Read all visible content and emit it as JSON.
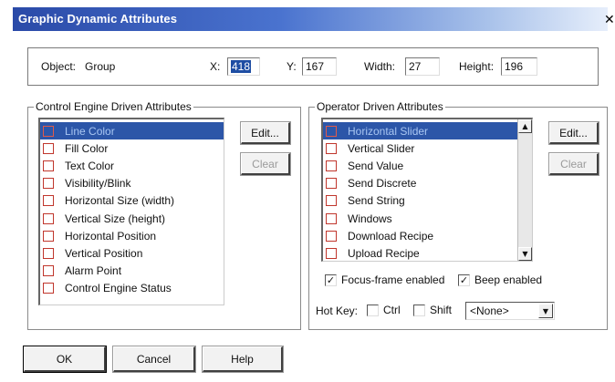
{
  "window": {
    "title": "Graphic Dynamic Attributes",
    "close_icon": "x-icon"
  },
  "object": {
    "label": "Object:",
    "name": "Group",
    "x_label": "X:",
    "x_value": "418",
    "y_label": "Y:",
    "y_value": "167",
    "width_label": "Width:",
    "width_value": "27",
    "height_label": "Height:",
    "height_value": "196"
  },
  "control_engine": {
    "legend": "Control Engine Driven Attributes",
    "items": [
      "Line Color",
      "Fill Color",
      "Text Color",
      "Visibility/Blink",
      "Horizontal Size (width)",
      "Vertical Size (height)",
      "Horizontal Position",
      "Vertical Position",
      "Alarm Point",
      "Control Engine Status"
    ],
    "selected_index": 0,
    "edit_label": "Edit...",
    "clear_label": "Clear"
  },
  "operator": {
    "legend": "Operator Driven Attributes",
    "items": [
      "Horizontal Slider",
      "Vertical Slider",
      "Send Value",
      "Send Discrete",
      "Send String",
      "Windows",
      "Download Recipe",
      "Upload Recipe"
    ],
    "selected_index": 0,
    "edit_label": "Edit...",
    "clear_label": "Clear",
    "focus_frame_label": "Focus-frame enabled",
    "focus_frame_checked": true,
    "beep_label": "Beep enabled",
    "beep_checked": true,
    "hotkey_label": "Hot Key:",
    "ctrl_label": "Ctrl",
    "ctrl_checked": false,
    "shift_label": "Shift",
    "shift_checked": false,
    "hotkey_value": "<None>"
  },
  "buttons": {
    "ok": "OK",
    "cancel": "Cancel",
    "help": "Help"
  },
  "colors": {
    "selection": "#2c56a8",
    "checkbox_border": "#c0362c",
    "title_start": "#2a4aa8"
  }
}
